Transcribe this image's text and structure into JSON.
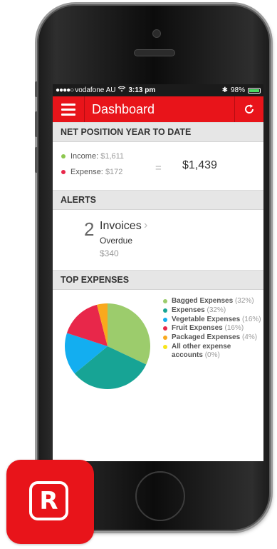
{
  "status_bar": {
    "signal": "●●●●○",
    "carrier": "vodafone AU",
    "wifi_icon": "wifi-icon",
    "time": "3:13 pm",
    "bluetooth_icon": "bluetooth-icon",
    "battery": "98%",
    "battery_level": 0.98
  },
  "app_bar": {
    "menu_icon": "hamburger-menu-icon",
    "title": "Dashboard",
    "refresh_icon": "refresh-icon",
    "color": "#e8141a"
  },
  "net_position": {
    "header": "NET POSITION YEAR TO DATE",
    "income_label": "Income:",
    "income_value": "$1,611",
    "income_color": "#8dc74f",
    "expense_label": "Expense:",
    "expense_value": "$172",
    "expense_color": "#e8274a",
    "equals": "=",
    "total": "$1,439"
  },
  "alerts": {
    "header": "ALERTS",
    "count": "2",
    "title": "Invoices",
    "chevron": "›",
    "subtitle": "Overdue",
    "amount": "$340"
  },
  "top_expenses": {
    "header": "TOP EXPENSES",
    "items": [
      {
        "name": "Bagged Expenses",
        "pct": "(32%)",
        "value": 32,
        "color": "#9ccc6c"
      },
      {
        "name": "Expenses",
        "pct": "(32%)",
        "value": 32,
        "color": "#17a495"
      },
      {
        "name": "Vegetable Expenses",
        "pct": "(16%)",
        "value": 16,
        "color": "#13aef0"
      },
      {
        "name": "Fruit Expenses",
        "pct": "(16%)",
        "value": 16,
        "color": "#e8274a"
      },
      {
        "name": "Packaged Expenses",
        "pct": "(4%)",
        "value": 4,
        "color": "#f9a91d"
      },
      {
        "name": "All other expense accounts",
        "pct": "(0%)",
        "value": 0,
        "color": "#f7e51b"
      }
    ]
  },
  "app_icon": {
    "letter": "R",
    "color": "#e8141a"
  }
}
